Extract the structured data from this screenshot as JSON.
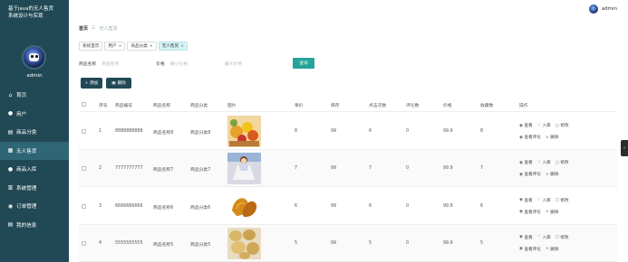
{
  "app": {
    "brand_line1": "基于java的无人售货",
    "brand_line2": "系统设计与实现",
    "sidebar_user": "admin",
    "top_user": "admin"
  },
  "sidebar": {
    "items": [
      {
        "label": "首页",
        "icon": "home-icon",
        "glyph": "⌂"
      },
      {
        "label": "用户",
        "icon": "user-icon",
        "glyph": "●"
      },
      {
        "label": "商品分类",
        "icon": "category-icon",
        "glyph": "▤"
      },
      {
        "label": "无人售货",
        "icon": "vending-icon",
        "glyph": "▦",
        "active": true
      },
      {
        "label": "商品入库",
        "icon": "stock-in-icon",
        "glyph": "●"
      },
      {
        "label": "系统管理",
        "icon": "system-icon",
        "glyph": "▥"
      },
      {
        "label": "订单管理",
        "icon": "order-icon",
        "glyph": "◉"
      },
      {
        "label": "我的信息",
        "icon": "profile-icon",
        "glyph": "▤"
      }
    ]
  },
  "breadcrumb": {
    "home": "首页",
    "sep": "☰",
    "current": "无人售货"
  },
  "tabs": [
    {
      "label": "系统首页",
      "closable": false
    },
    {
      "label": "用户",
      "closable": true
    },
    {
      "label": "商品分类",
      "closable": true
    },
    {
      "label": "无人售货",
      "closable": true,
      "active": true
    }
  ],
  "search": {
    "name_label": "商品名称",
    "name_placeholder": "商品名称",
    "price_label": "价格",
    "min_placeholder": "最小价格",
    "max_placeholder": "最大价格",
    "button": "查询"
  },
  "toolbar": {
    "add": "+ 添加",
    "delete": "删除"
  },
  "table": {
    "headers": [
      "序号",
      "商品编号",
      "商品名称",
      "商品分类",
      "图片",
      "单价",
      "库存",
      "点击次数",
      "评论数",
      "价格",
      "收藏数",
      "操作"
    ],
    "rows": [
      {
        "idx": "1",
        "code": "8888888888",
        "name": "商品名称8",
        "category": "商品分类8",
        "image": "fruit-basket-image",
        "unit_price": "8",
        "stock": "99",
        "clicks": "6",
        "comments": "0",
        "price": "99.9",
        "favorites": "8"
      },
      {
        "idx": "2",
        "code": "7777777777",
        "name": "商品名称7",
        "category": "商品分类7",
        "image": "doll-image",
        "unit_price": "7",
        "stock": "99",
        "clicks": "7",
        "comments": "0",
        "price": "99.9",
        "favorites": "7"
      },
      {
        "idx": "3",
        "code": "6666666666",
        "name": "商品名称6",
        "category": "商品分类6",
        "image": "dried-fruit-image",
        "unit_price": "6",
        "stock": "99",
        "clicks": "6",
        "comments": "0",
        "price": "99.9",
        "favorites": "6"
      },
      {
        "idx": "4",
        "code": "5555555555",
        "name": "商品名称5",
        "category": "商品分类5",
        "image": "potatoes-image",
        "unit_price": "5",
        "stock": "99",
        "clicks": "5",
        "comments": "0",
        "price": "99.9",
        "favorites": "5"
      }
    ],
    "actions": {
      "view": "查看",
      "stock_in": "入库",
      "edit": "修改",
      "review": "查看评论",
      "delete": "删除"
    }
  },
  "colors": {
    "sidebar": "#214955",
    "accent": "#26a39b",
    "active_tab": "#d5f2f5"
  }
}
